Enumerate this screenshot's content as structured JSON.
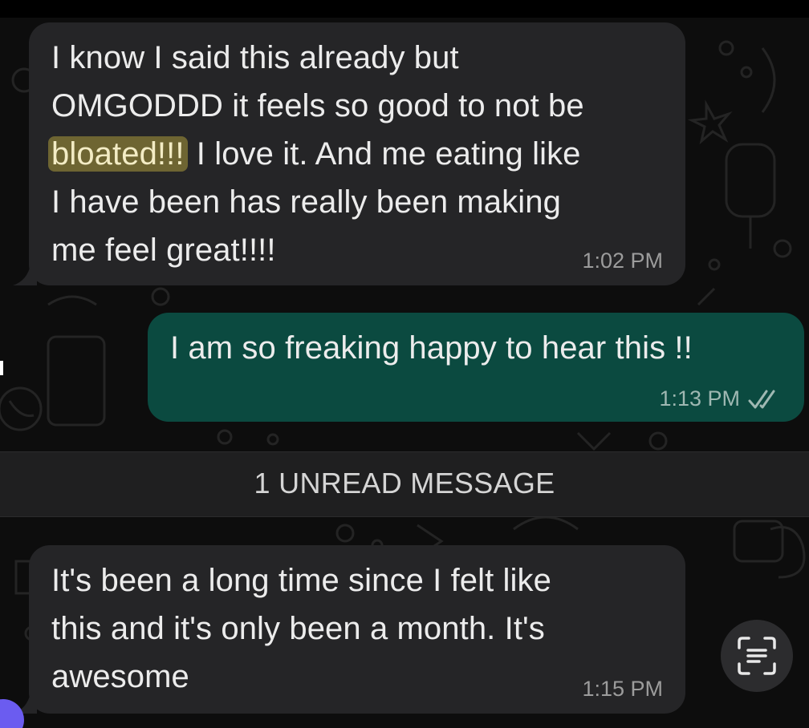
{
  "messages": [
    {
      "direction": "incoming",
      "highlight": "bloated!!!",
      "text_before": "I know I said this already but\nOMGODDD it feels so good to not be\n",
      "text_after": " I love it. And me eating like\nI have been has really been making\nme feel great!!!!",
      "time": "1:02 PM"
    },
    {
      "direction": "outgoing",
      "text": "I am so freaking happy to hear this !!",
      "time": "1:13 PM",
      "status": "read-double-check-icon"
    },
    {
      "direction": "incoming",
      "text": "It's been a long time since I felt like\nthis and it's only been a month. It's\nawesome",
      "time": "1:15 PM"
    }
  ],
  "unread_divider": {
    "label": "1 UNREAD MESSAGE"
  },
  "floating_action": {
    "icon": "text-scan-icon"
  },
  "colors": {
    "incoming_bubble": "#252527",
    "outgoing_bubble": "#0b4a40",
    "highlight": "#6e6532",
    "background": "#0d0d0d"
  }
}
